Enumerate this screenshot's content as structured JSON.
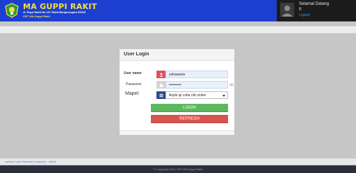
{
  "header": {
    "school_name": "MA GUPPI RAKIT",
    "address": "Jl. Raya Rakit No.127 Rakit Banjarnegara 53463",
    "ids": "CBT MA Guppi Rakit",
    "logo_icon": "school-crest-icon",
    "background_color": "#1d3fd0",
    "title_color": "#f1e040"
  },
  "user_panel": {
    "greeting": "Selamat Datang",
    "user": "0",
    "logout_label": "Logout",
    "avatar_icon": "user-silhouette-icon"
  },
  "login": {
    "title": "User Login",
    "username_label": "User name",
    "username_value": "yokowasis",
    "password_label": "Password",
    "password_value": "••••••••••",
    "mapel_label": "Mapel",
    "mapel_selected": "Asyik uji coba cbt online",
    "login_button": "LOGIN",
    "refresh_button": "REFRESH",
    "icons": {
      "username": "user-icon",
      "password": "lock-icon",
      "mapel": "list-icon",
      "show_password": "eye-icon"
    },
    "colors": {
      "login": "#5cb85c",
      "refresh": "#d9534f",
      "username_addon": "#e05060",
      "mapel_addon": "#2a4d8a"
    }
  },
  "bottom_bar": {
    "text": "Aplikasi Ujian Berbasis Komputer - #####"
  },
  "footer": {
    "text": "© Copyright 2015, CBT MA Guppi Rakit"
  }
}
